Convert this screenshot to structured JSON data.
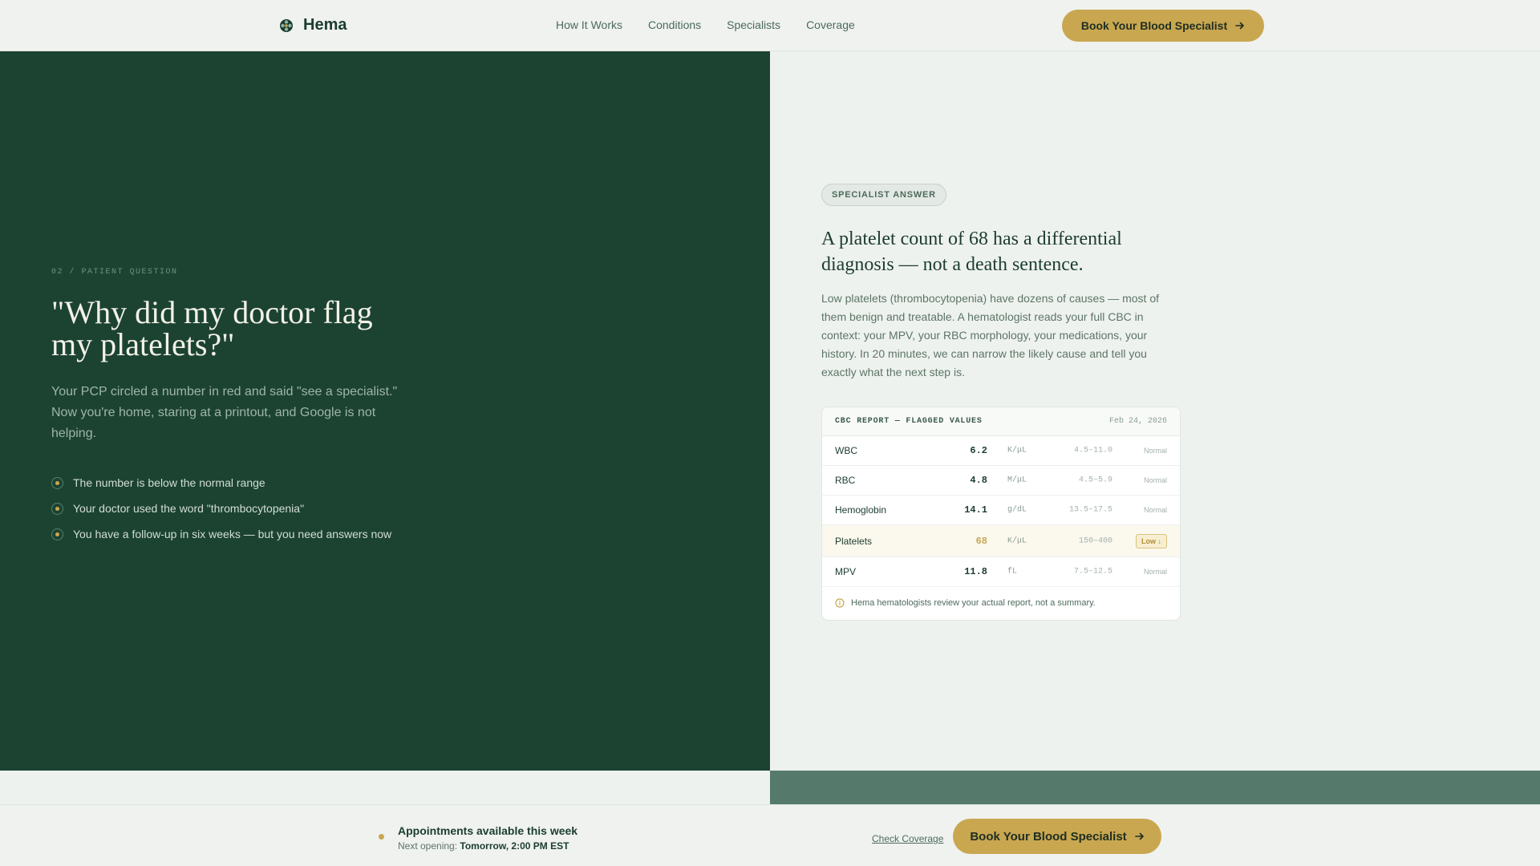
{
  "colors": {
    "brand_dark": "#1c4332",
    "accent_gold": "#c9a750",
    "muted_green": "#557a6c",
    "background": "#eef2ee"
  },
  "header": {
    "logo_icon": "flower-logo-icon",
    "logo_text": "Hema",
    "nav": [
      "How It Works",
      "Conditions",
      "Specialists",
      "Coverage"
    ],
    "cta_label": "Book Your Blood Specialist",
    "cta_icon": "arrow-right-icon"
  },
  "left": {
    "eyebrow": "02 / PATIENT QUESTION",
    "question": "\"Why did my doctor flag my platelets?\"",
    "intro": "Your PCP circled a number in red and said \"see a specialist.\" Now you're home, staring at a printout, and Google is not helping.",
    "bullets": [
      "The number is below the normal range",
      "Your doctor used the word \"thrombocytopenia\"",
      "You have a follow-up in six weeks — but you need answers now"
    ]
  },
  "right": {
    "pill": "SPECIALIST ANSWER",
    "title": "A platelet count of 68 has a differential diagnosis — not a death sentence.",
    "body": "Low platelets (thrombocytopenia) have dozens of causes — most of them benign and treatable. A hematologist reads your full CBC in context: your MPV, your RBC morphology, your medications, your history. In 20 minutes, we can narrow the likely cause and tell you exactly what the next step is.",
    "card": {
      "title": "CBC REPORT — FLAGGED VALUES",
      "date": "Feb 24, 2026",
      "rows": [
        {
          "name": "WBC",
          "value": "6.2",
          "unit": "K/μL",
          "range": "4.5–11.0",
          "status": "Normal"
        },
        {
          "name": "RBC",
          "value": "4.8",
          "unit": "M/μL",
          "range": "4.5–5.9",
          "status": "Normal"
        },
        {
          "name": "Hemoglobin",
          "value": "14.1",
          "unit": "g/dL",
          "range": "13.5–17.5",
          "status": "Normal"
        },
        {
          "name": "Platelets",
          "value": "68",
          "unit": "K/μL",
          "range": "150–400",
          "status": "Low ↓"
        },
        {
          "name": "MPV",
          "value": "11.8",
          "unit": "fL",
          "range": "7.5–12.5",
          "status": "Normal"
        }
      ],
      "footnote_icon": "info-icon",
      "footnote": "Hema hematologists review your actual report, not a summary."
    }
  },
  "bottom_bar": {
    "title": "Appointments available this week",
    "sub_label": "Next opening:",
    "sub_value": "Tomorrow, 2:00 PM EST",
    "link_label": "Check Coverage",
    "cta_label": "Book Your Blood Specialist",
    "cta_icon": "arrow-right-icon"
  }
}
